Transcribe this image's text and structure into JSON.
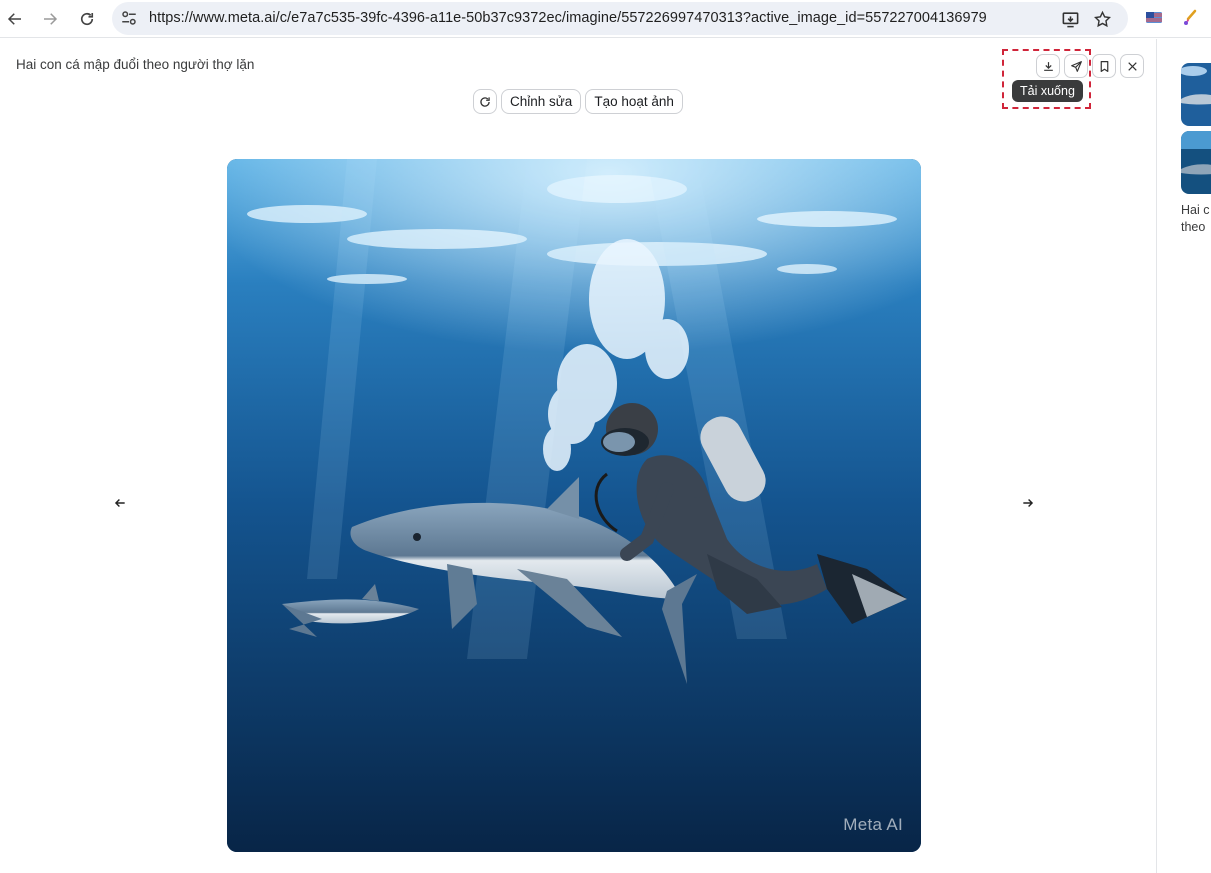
{
  "browser": {
    "url": "https://www.meta.ai/c/e7a7c535-39fc-4396-a11e-50b37c9372ec/imagine/557226997470313?active_image_id=557227004136979",
    "back_icon": "arrow-left-icon",
    "forward_icon": "arrow-right-icon",
    "reload_icon": "reload-icon",
    "site_info_icon": "tune-icon",
    "install_icon": "install-app-icon",
    "bookmark_icon": "star-icon"
  },
  "viewer": {
    "caption": "Hai con cá mập đuổi theo người thợ lặn",
    "regenerate_icon": "refresh-icon",
    "edit_label": "Chỉnh sửa",
    "animate_label": "Tạo hoạt ảnh",
    "download_tooltip": "Tải xuống",
    "watermark": "Meta AI",
    "prev_icon": "arrow-left-icon",
    "next_icon": "arrow-right-icon",
    "actions": [
      "download-icon",
      "share-icon",
      "bookmark-icon",
      "close-icon"
    ]
  },
  "sidebar": {
    "item_text_line1": "Hai c",
    "item_text_line2": "theo"
  },
  "colors": {
    "accent_highlight": "#d0253a",
    "water_deep": "#0b2f57",
    "water_light": "#3b8fd0"
  }
}
